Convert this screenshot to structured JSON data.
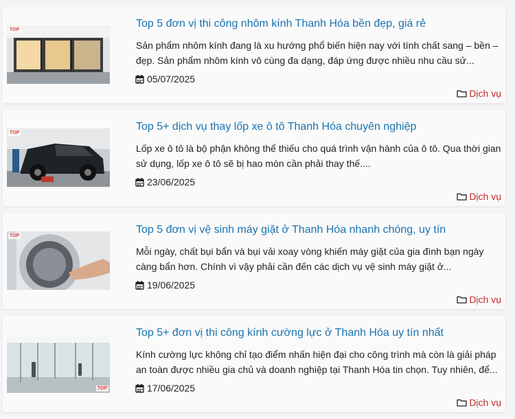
{
  "posts": [
    {
      "title": "Top 5 đơn vị thi công nhôm kính Thanh Hóa bền đẹp, giá rẻ",
      "excerpt": "Sản phẩm nhôm kính đang là xu hướng phổ biến hiện nay với tính chất sang – bền – đẹp. Sản phẩm nhôm kính vô cùng đa dạng, đáp ứng được nhiều nhu cầu sử...",
      "date": "05/07/2025",
      "category": "Dịch vụ",
      "badge": "TOP"
    },
    {
      "title": "Top 5+ dịch vụ thay lốp xe ô tô Thanh Hóa chuyên nghiệp",
      "excerpt": "Lốp xe ô tô là bộ phận không thể thiếu cho quá trình vận hành của ô tô. Qua thời gian sử dụng, lốp xe ô tô sẽ bị hao mòn cần phải thay thế....",
      "date": "23/06/2025",
      "category": "Dịch vụ",
      "badge": "TOP"
    },
    {
      "title": "Top 5 đơn vị vệ sinh máy giặt ở Thanh Hóa nhanh chóng, uy tín",
      "excerpt": "Mỗi ngày, chất bụi bẩn và bụi vải xoay vòng khiến máy giặt của gia đình bạn ngày càng bẩn hơn. Chính vì vậy phải cần đến các dịch vụ vệ sinh máy giặt ở...",
      "date": "19/06/2025",
      "category": "Dịch vụ",
      "badge": "TOP"
    },
    {
      "title": "Top 5+ đơn vị thi công kính cường lực ở Thanh Hóa uy tín nhất",
      "excerpt": "Kính cường lực không chỉ tạo điểm nhấn hiện đại cho công trình mà còn là giải pháp an toàn được nhiều gia chủ và doanh nghiệp tại Thanh Hóa tin chọn. Tuy nhiên, để...",
      "date": "17/06/2025",
      "category": "Dịch vụ",
      "badge": "TOP"
    }
  ],
  "icons": {
    "date": "calendar-icon",
    "category": "folder-icon"
  },
  "colors": {
    "title": "#1a73b0",
    "category": "#c62828",
    "card": "#fafafa",
    "page": "#f3f4f6"
  }
}
